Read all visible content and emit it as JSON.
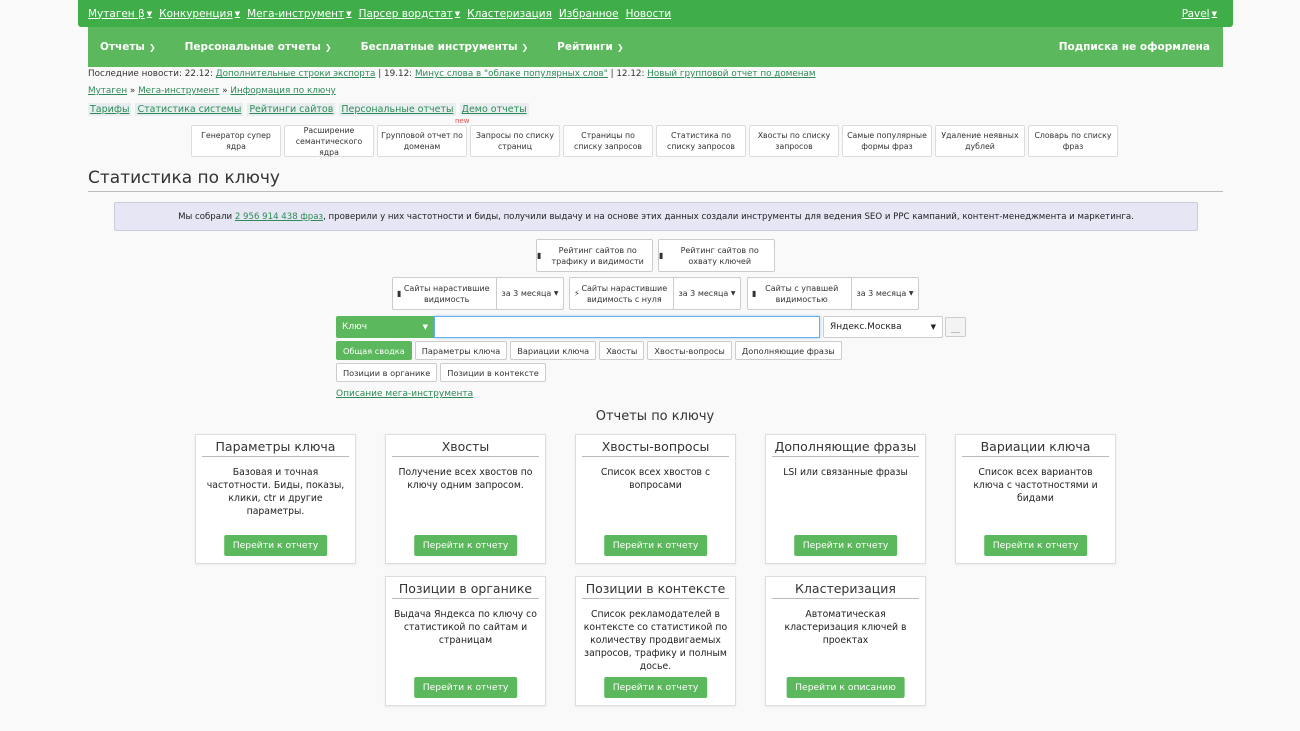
{
  "topbar": {
    "items": [
      {
        "label": "Мутаген β",
        "caret": true
      },
      {
        "label": "Конкуренция",
        "caret": true
      },
      {
        "label": "Мега-инструмент",
        "caret": true
      },
      {
        "label": "Парсер вордстат",
        "caret": true
      },
      {
        "label": "Кластеризация",
        "caret": false
      },
      {
        "label": "Избранное",
        "caret": false
      },
      {
        "label": "Новости",
        "caret": false
      }
    ],
    "user": "Pavel"
  },
  "navbar": {
    "items": [
      "Отчеты",
      "Персональные отчеты",
      "Бесплатные инструменты",
      "Рейтинги"
    ],
    "subscription": "Подписка не оформлена"
  },
  "news": {
    "prefix": "Последние новости: 22.12:",
    "n1": "Дополнительные строки экспорта",
    "sep1": "| 19.12:",
    "n2": "Минус слова в \"облаке популярных слов\"",
    "sep2": "| 12.12:",
    "n3": "Новый групповой отчет по доменам"
  },
  "breadcrumb": {
    "c1": "Мутаген",
    "sep": "»",
    "c2": "Мега-инструмент",
    "c3": "Информация по ключу"
  },
  "tabs": [
    "Тарифы",
    "Статистика системы",
    "Рейтинги сайтов",
    "Персональные отчеты",
    "Демо отчеты"
  ],
  "new_badge": "new",
  "tools": [
    "Генератор супер ядра",
    "Расширение семантического ядра",
    "Групповой отчет по доменам",
    "Запросы по списку страниц",
    "Страницы по списку запросов",
    "Статистика по списку запросов",
    "Хвосты по списку запросов",
    "Самые популярные формы фраз",
    "Удаление неявных дублей",
    "Словарь по списку фраз"
  ],
  "page_title": "Статистика по ключу",
  "info": {
    "pre": "Мы собрали",
    "count": "2 956 914 438 фраз",
    "post": ", проверили у них частотности и биды, получили выдачу и на основе этих данных создали инструменты для ведения SEO и PPC кампаний, контент-менеджмента и маркетинга."
  },
  "ratings": {
    "traffic": "Рейтинг сайтов по трафику и видимости",
    "coverage": "Рейтинг сайтов по охвату ключей"
  },
  "visibility": {
    "grow": "Сайты нарастившие видимость",
    "grow_period": "за 3 месяца",
    "zero": "Сайты нарастившие видимость с нуля",
    "zero_period": "за 3 месяца",
    "drop": "Сайты с упавшей видимостью",
    "drop_period": "за 3 месяца"
  },
  "search": {
    "type": "Ключ",
    "value": "",
    "region": "Яндекс.Москва"
  },
  "report_tabs": [
    "Общая сводка",
    "Параметры ключа",
    "Вариации ключа",
    "Хвосты",
    "Хвосты-вопросы",
    "Дополняющие фразы",
    "Позиции в органике",
    "Позиции в контексте"
  ],
  "description_link": "Описание мега-инструмента",
  "reports_heading": "Отчеты по ключу",
  "cards": [
    {
      "title": "Параметры ключа",
      "desc": "Базовая и точная частотности. Биды, показы, клики, ctr и другие параметры.",
      "button": "Перейти к отчету"
    },
    {
      "title": "Хвосты",
      "desc": "Получение всех хвостов по ключу одним запросом.",
      "button": "Перейти к отчету"
    },
    {
      "title": "Хвосты-вопросы",
      "desc": "Список всех хвостов с вопросами",
      "button": "Перейти к отчету"
    },
    {
      "title": "Дополняющие фразы",
      "desc": "LSI или связанные фразы",
      "button": "Перейти к отчету"
    },
    {
      "title": "Вариации ключа",
      "desc": "Список всех вариантов ключа с частотностями и бидами",
      "button": "Перейти к отчету"
    },
    {
      "title": "Позиции в органике",
      "desc": "Выдача Яндекса по ключу со статистикой по сайтам и страницам",
      "button": "Перейти к отчету"
    },
    {
      "title": "Позиции в контексте",
      "desc": "Список рекламодателей в контексте со статистикой по количеству продвигаемых запросов, трафику и полным досье.",
      "button": "Перейти к отчету"
    },
    {
      "title": "Кластеризация",
      "desc": "Автоматическая кластеризация ключей в проектах",
      "button": "Перейти к описанию"
    }
  ],
  "colors": {
    "primary": "#5cb85c",
    "topbar": "#3fae49",
    "link": "#2e8b57",
    "info_bg": "#e6e6f5"
  }
}
